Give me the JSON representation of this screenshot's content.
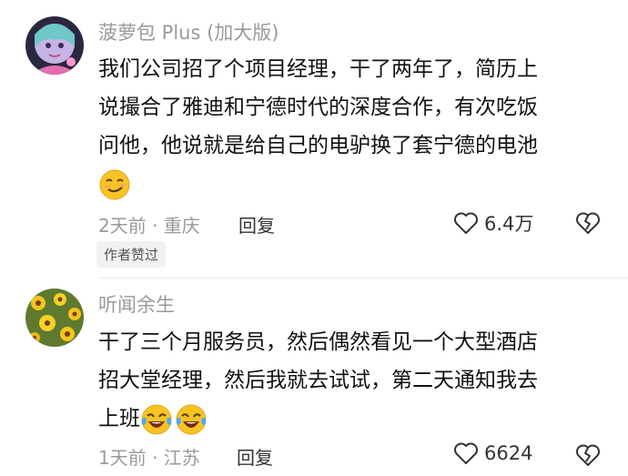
{
  "comments": [
    {
      "username": "菠萝包 Plus (加大版)",
      "lines": [
        "我们公司招了个项目经理，干了两年了，简历上",
        "说撮合了雅迪和宁德时代的深度合作，有次吃饭",
        "问他，他说就是给自己的电驴换了套宁德的电池"
      ],
      "emojis": [
        "smirk-face-emoji"
      ],
      "time_location": "2天前 · 重庆",
      "reply_label": "回复",
      "like_count": "6.4万",
      "badge": "作者赞过"
    },
    {
      "username": "听闻余生",
      "lines": [
        "干了三个月服务员，然后偶然看见一个大型酒店",
        "招大堂经理，然后我就去试试，第二天通知我去",
        "上班"
      ],
      "emojis": [
        "tears-of-joy-emoji",
        "tears-of-joy-emoji"
      ],
      "time_location": "1天前 · 江苏",
      "reply_label": "回复",
      "like_count": "6624"
    }
  ],
  "colors": {
    "meta_gray": "#9a9a9a",
    "emoji_yellow": "#f7c325"
  }
}
